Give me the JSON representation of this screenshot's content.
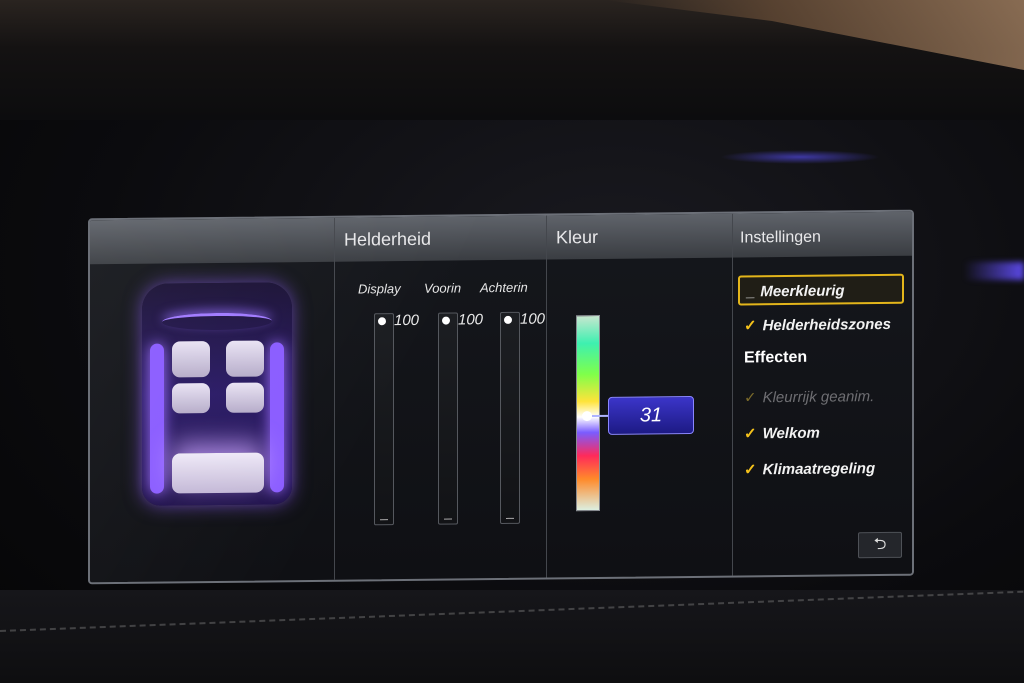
{
  "columns": {
    "helderheid": "Helderheid",
    "kleur": "Kleur",
    "instellingen": "Instellingen"
  },
  "brightness": {
    "display": {
      "label": "Display",
      "value": "100"
    },
    "voorin": {
      "label": "Voorin",
      "value": "100"
    },
    "achterin": {
      "label": "Achterin",
      "value": "100"
    }
  },
  "color": {
    "value": "31"
  },
  "menu": {
    "meerkleurig": "Meerkleurig",
    "helderheidszones": "Helderheidszones",
    "effecten": "Effecten",
    "kleurrijk": "Kleurrijk geanim.",
    "welkom": "Welkom",
    "klimaatregeling": "Klimaatregeling",
    "check_icon": "✓",
    "back_icon": "⮌"
  },
  "accent": "#e3b51b",
  "ambient_color": "#8a5cff"
}
